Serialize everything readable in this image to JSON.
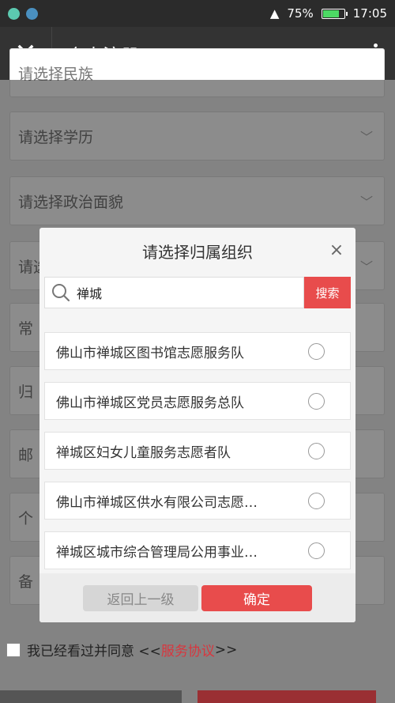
{
  "status_bar": {
    "battery": "75%",
    "battery_level": 0.75,
    "time": "17:05"
  },
  "title_bar": {
    "title": "个人注册"
  },
  "form": {
    "fields": [
      {
        "placeholder": "请选择民族"
      },
      {
        "placeholder": "请选择学历"
      },
      {
        "placeholder": "请选择政治面貌"
      },
      {
        "placeholder": "请选择归属组织"
      },
      {
        "placeholder": "常"
      },
      {
        "placeholder": "归"
      },
      {
        "placeholder": "邮"
      },
      {
        "placeholder": "个"
      },
      {
        "placeholder": "备"
      }
    ],
    "agree_text": "我已经看过并同意 <<",
    "agree_link": "服务协议",
    "agree_suffix": ">>"
  },
  "dialog": {
    "title": "请选择归属组织",
    "close": "×",
    "search_value": "禅城",
    "search_button": "搜索",
    "items": [
      {
        "label": "佛山市禅城区图书馆志愿服务队"
      },
      {
        "label": "佛山市禅城区党员志愿服务总队"
      },
      {
        "label": "禅城区妇女儿童服务志愿者队"
      },
      {
        "label": "佛山市禅城区供水有限公司志愿…"
      },
      {
        "label": "禅城区城市综合管理局公用事业…"
      }
    ],
    "back_button": "返回上一级",
    "ok_button": "确定"
  },
  "colors": {
    "accent": "#e84c4c",
    "titlebar": "#333333"
  }
}
